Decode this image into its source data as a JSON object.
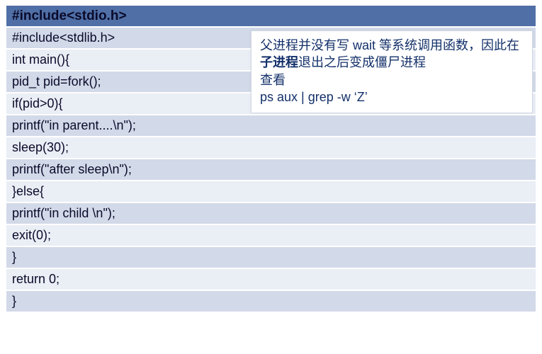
{
  "code": {
    "header": "#include<stdio.h>",
    "lines": [
      "#include<stdlib.h>",
      "int main(){",
      "pid_t pid=fork();",
      "if(pid>0){",
      "printf(\"in parent....\\n\");",
      "sleep(30);",
      "printf(\"after sleep\\n\");",
      "}else{",
      "printf(\"in child \\n\");",
      "exit(0);",
      "}",
      "return 0;",
      "}"
    ]
  },
  "callout": {
    "p1a": "父进程并没有写 wait 等系统调用函数，因此在",
    "p1_bold": "子进程",
    "p1b": "退出之后变成僵尸进程",
    "p2": "查看",
    "p3": "ps aux | grep -w  ‘Z’"
  }
}
